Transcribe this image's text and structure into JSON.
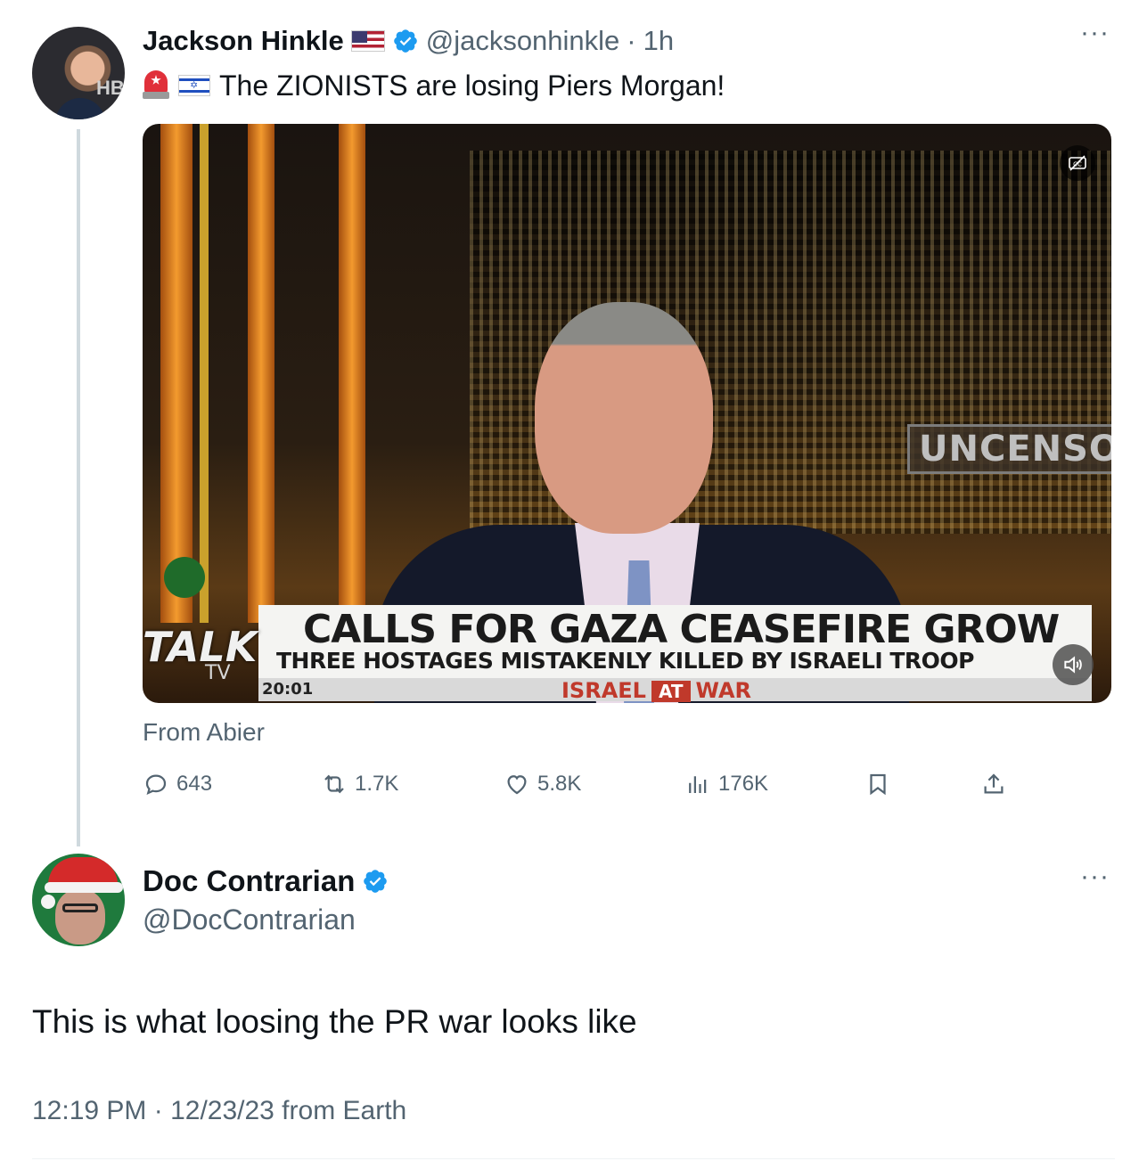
{
  "tweet1": {
    "name": "Jackson Hinkle",
    "handle": "@jacksonhinkle",
    "separator": "·",
    "time": "1h",
    "text": "The ZIONISTS are losing Piers Morgan!",
    "emoji_icons": [
      "police-light-icon",
      "israel-flag-icon"
    ],
    "name_icons": [
      "us-flag-icon",
      "verified-badge-icon"
    ],
    "more": "···",
    "video": {
      "overlay_uncensored": "UNCENSOR",
      "headline": "CALLS FOR GAZA CEASEFIRE GROW",
      "subheadline": "THREE HOSTAGES MISTAKENLY KILLED BY ISRAELI TROOP",
      "clock": "20:01",
      "ticker_left": "ISRAEL",
      "ticker_at": "AT",
      "ticker_right": "WAR",
      "logo": "TALK",
      "logo_sub": "TV"
    },
    "source": "From Abier",
    "stats": {
      "replies": "643",
      "reposts": "1.7K",
      "likes": "5.8K",
      "views": "176K"
    }
  },
  "tweet2": {
    "name": "Doc Contrarian",
    "handle": "@DocContrarian",
    "more": "···",
    "text": "This is what loosing the PR war looks like",
    "meta": "12:19 PM · 12/23/23 from Earth"
  },
  "colors": {
    "verified_blue": "#1d9bf0",
    "secondary_text": "#536471",
    "thread_line": "#cfd9de"
  }
}
